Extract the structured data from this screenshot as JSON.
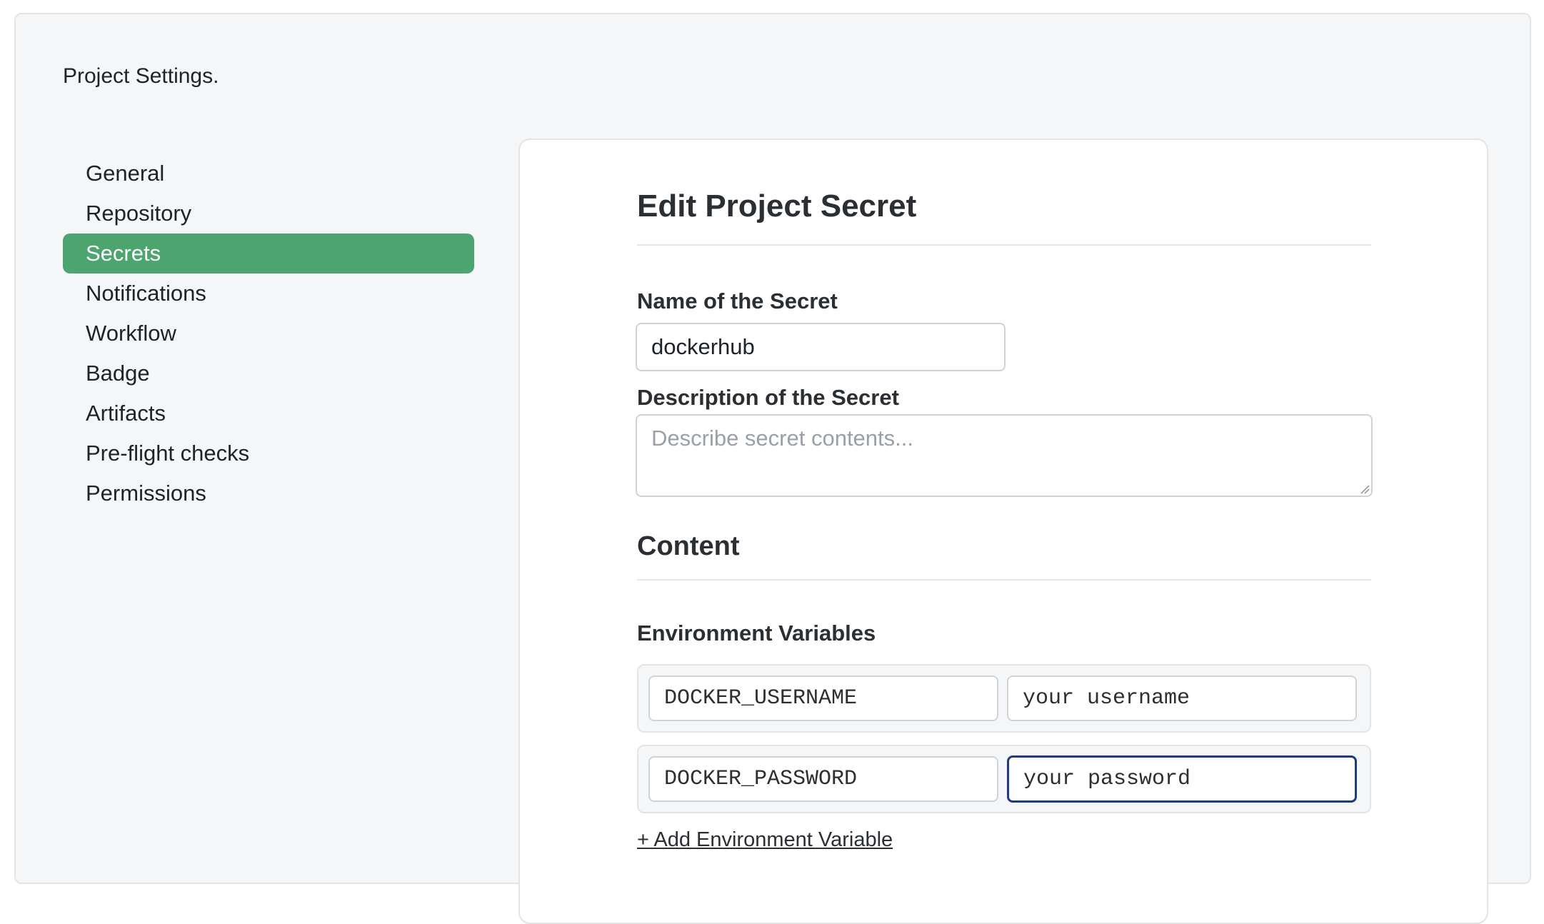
{
  "page": {
    "title": "Project Settings."
  },
  "sidebar": {
    "items": [
      {
        "label": "General"
      },
      {
        "label": "Repository"
      },
      {
        "label": "Secrets"
      },
      {
        "label": "Notifications"
      },
      {
        "label": "Workflow"
      },
      {
        "label": "Badge"
      },
      {
        "label": "Artifacts"
      },
      {
        "label": "Pre-flight checks"
      },
      {
        "label": "Permissions"
      }
    ],
    "active": "Secrets"
  },
  "form": {
    "title": "Edit Project Secret",
    "name_label": "Name of the Secret",
    "name_value": "dockerhub",
    "description_label": "Description of the Secret",
    "description_placeholder": "Describe secret contents...",
    "description_value": "",
    "content_title": "Content",
    "env_vars_label": "Environment Variables",
    "env_vars": [
      {
        "key": "DOCKER_USERNAME",
        "value": "your username"
      },
      {
        "key": "DOCKER_PASSWORD",
        "value": "your password"
      }
    ],
    "add_env_var_label": "+ Add Environment Variable"
  },
  "colors": {
    "accent": "#4ca56f",
    "focus_border": "#1b3a8a",
    "page_background": "#f5f6f7"
  },
  "icons": {
    "textarea_resize": "resize-grip-icon"
  }
}
